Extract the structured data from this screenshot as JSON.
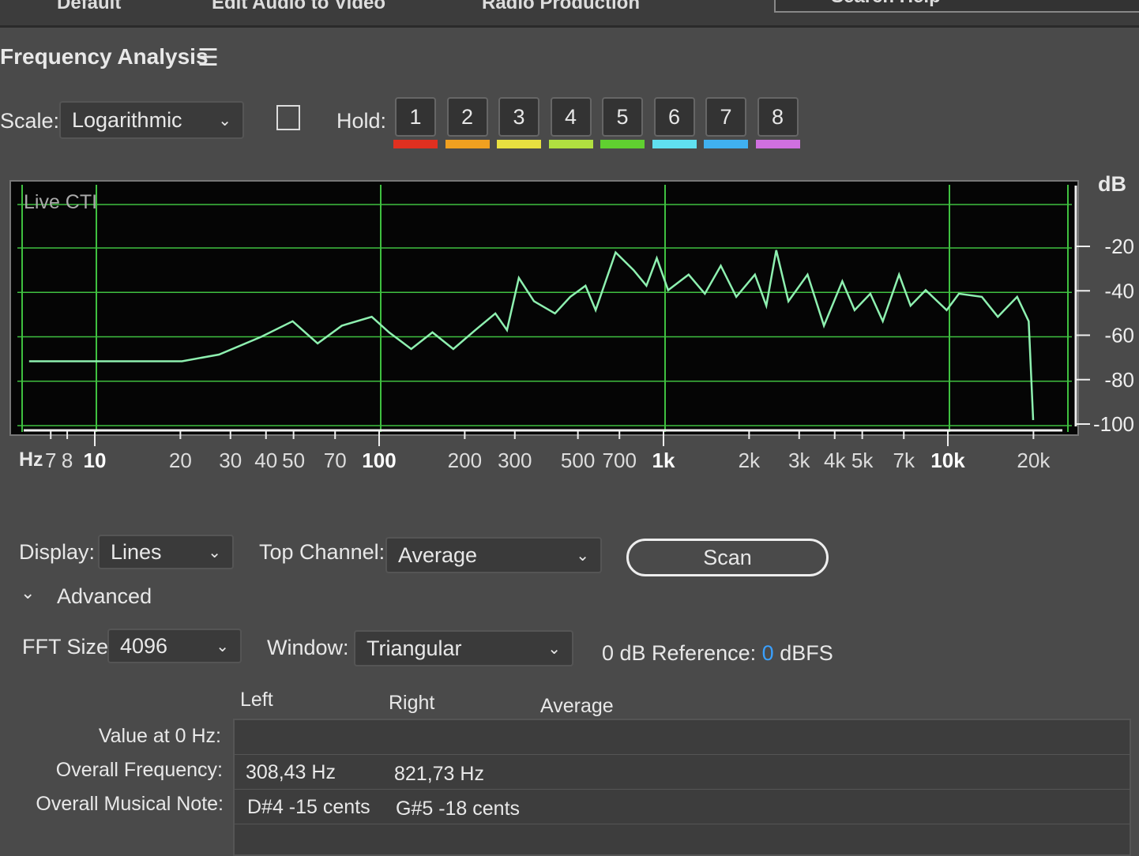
{
  "topbar": {
    "items": [
      "Default",
      "Edit Audio to Video",
      "Radio Production"
    ],
    "search": "Search Help"
  },
  "panel": {
    "title": "Frequency Analysis",
    "menu_icon": "hamburger-icon"
  },
  "scale": {
    "label": "Scale:",
    "value": "Logarithmic"
  },
  "hold": {
    "label": "Hold:",
    "buttons": [
      {
        "label": "1",
        "color": "#e03020"
      },
      {
        "label": "2",
        "color": "#f0a020"
      },
      {
        "label": "3",
        "color": "#e8e040"
      },
      {
        "label": "4",
        "color": "#b0e040"
      },
      {
        "label": "5",
        "color": "#60d030"
      },
      {
        "label": "6",
        "color": "#60e0f0"
      },
      {
        "label": "7",
        "color": "#40b0f0"
      },
      {
        "label": "8",
        "color": "#d070e0"
      }
    ]
  },
  "chart_data": {
    "type": "line",
    "title": "",
    "annotation": "Live CTI",
    "xlabel": "Hz",
    "ylabel": "dB",
    "xscale": "log",
    "xlim": [
      5.5,
      24000
    ],
    "ylim": [
      -103,
      7
    ],
    "x_ticks": [
      {
        "v": 7,
        "l": "7"
      },
      {
        "v": 8,
        "l": "8"
      },
      {
        "v": 10,
        "l": "10",
        "major": true
      },
      {
        "v": 20,
        "l": "20"
      },
      {
        "v": 30,
        "l": "30"
      },
      {
        "v": 40,
        "l": "40"
      },
      {
        "v": 50,
        "l": "50"
      },
      {
        "v": 70,
        "l": "70"
      },
      {
        "v": 100,
        "l": "100",
        "major": true
      },
      {
        "v": 200,
        "l": "200"
      },
      {
        "v": 300,
        "l": "300"
      },
      {
        "v": 500,
        "l": "500"
      },
      {
        "v": 700,
        "l": "700"
      },
      {
        "v": 1000,
        "l": "1k",
        "major": true
      },
      {
        "v": 2000,
        "l": "2k"
      },
      {
        "v": 3000,
        "l": "3k"
      },
      {
        "v": 4000,
        "l": "4k"
      },
      {
        "v": 5000,
        "l": "5k"
      },
      {
        "v": 7000,
        "l": "7k"
      },
      {
        "v": 10000,
        "l": "10k",
        "major": true
      },
      {
        "v": 20000,
        "l": "20k"
      }
    ],
    "y_ticks": [
      -20,
      -40,
      -60,
      -80,
      -100
    ],
    "grid": true,
    "color": "#8ef0b0",
    "series": [
      {
        "name": "Average",
        "x": [
          5.8,
          11,
          20,
          27,
          38,
          49,
          60,
          73,
          93,
          107,
          128,
          152,
          180,
          215,
          253,
          278,
          306,
          346,
          410,
          464,
          525,
          570,
          670,
          775,
          860,
          935,
          1025,
          1210,
          1380,
          1570,
          1780,
          2070,
          2270,
          2460,
          2715,
          3170,
          3620,
          4200,
          4640,
          5270,
          5830,
          6650,
          7300,
          8250,
          9780,
          10800,
          13000,
          14800,
          17300,
          19000,
          19700
        ],
        "y": [
          -71,
          -71,
          -71,
          -68,
          -60,
          -53,
          -63,
          -55,
          -51,
          -58,
          -65.5,
          -58,
          -65.5,
          -57,
          -49.5,
          -57,
          -33.5,
          -44,
          -49.5,
          -42,
          -37,
          -48,
          -22,
          -30,
          -37,
          -24.6,
          -39,
          -32,
          -40.6,
          -28,
          -42,
          -32,
          -46,
          -21,
          -44,
          -32,
          -55,
          -35,
          -48,
          -40.6,
          -53,
          -32,
          -46,
          -39,
          -48,
          -40.6,
          -42,
          -51,
          -42,
          -53,
          -97.5
        ]
      }
    ]
  },
  "controls": {
    "display_label": "Display:",
    "display_value": "Lines",
    "top_channel_label": "Top Channel:",
    "top_channel_value": "Average",
    "scan": "Scan",
    "advanced": "Advanced",
    "fft_label": "FFT Size:",
    "fft_value": "4096",
    "window_label": "Window:",
    "window_value": "Triangular",
    "ref_label": "0 dB Reference:",
    "ref_value": "0",
    "ref_unit": "dBFS"
  },
  "table": {
    "headers": [
      "Left",
      "Right",
      "Average"
    ],
    "rows": [
      {
        "label": "Value at 0 Hz:",
        "left": "",
        "right": ""
      },
      {
        "label": "Overall Frequency:",
        "left": "308,43 Hz",
        "right": "821,73 Hz"
      },
      {
        "label": "Overall Musical Note:",
        "left": "D#4 -15 cents",
        "right": "G#5 -18 cents"
      }
    ]
  }
}
